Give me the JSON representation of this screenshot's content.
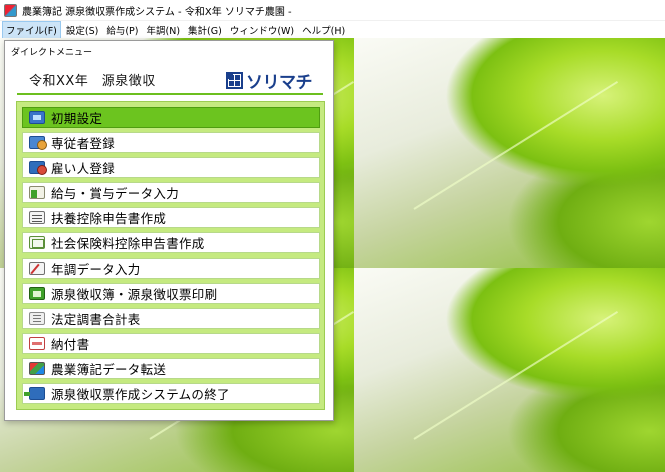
{
  "window": {
    "title": "農業簿記 源泉徴収票作成システム - 令和X年 ソリマチ農園 -"
  },
  "menubar": [
    {
      "label": "ファイル(F)"
    },
    {
      "label": "設定(S)"
    },
    {
      "label": "給与(P)"
    },
    {
      "label": "年調(N)"
    },
    {
      "label": "集計(G)"
    },
    {
      "label": "ウィンドウ(W)"
    },
    {
      "label": "ヘルプ(H)"
    }
  ],
  "dialog": {
    "caption": "ダイレクトメニュー",
    "heading": "令和XX年　源泉徴収",
    "logo_text": "ソリマチ",
    "items": [
      {
        "label": "初期設定",
        "icon": "settings-icon",
        "selected": true
      },
      {
        "label": "専従者登録",
        "icon": "employee-icon"
      },
      {
        "label": "雇い人登録",
        "icon": "hire-icon"
      },
      {
        "label": "給与・賞与データ入力",
        "icon": "salary-icon"
      },
      {
        "label": "扶養控除申告書作成",
        "icon": "dependent-icon"
      },
      {
        "label": "社会保険料控除申告書作成",
        "icon": "insurance-icon"
      },
      {
        "label": "年調データ入力",
        "icon": "yearend-icon"
      },
      {
        "label": "源泉徴収簿・源泉徴収票印刷",
        "icon": "print-icon"
      },
      {
        "label": "法定調書合計表",
        "icon": "statutory-icon"
      },
      {
        "label": "納付書",
        "icon": "payment-icon"
      },
      {
        "label": "農業簿記データ転送",
        "icon": "transfer-icon"
      },
      {
        "label": "源泉徴収票作成システムの終了",
        "icon": "exit-icon"
      }
    ]
  },
  "colors": {
    "accent": "#6cc41f",
    "panel": "#c5ea80",
    "logo": "#1a3f8c"
  }
}
